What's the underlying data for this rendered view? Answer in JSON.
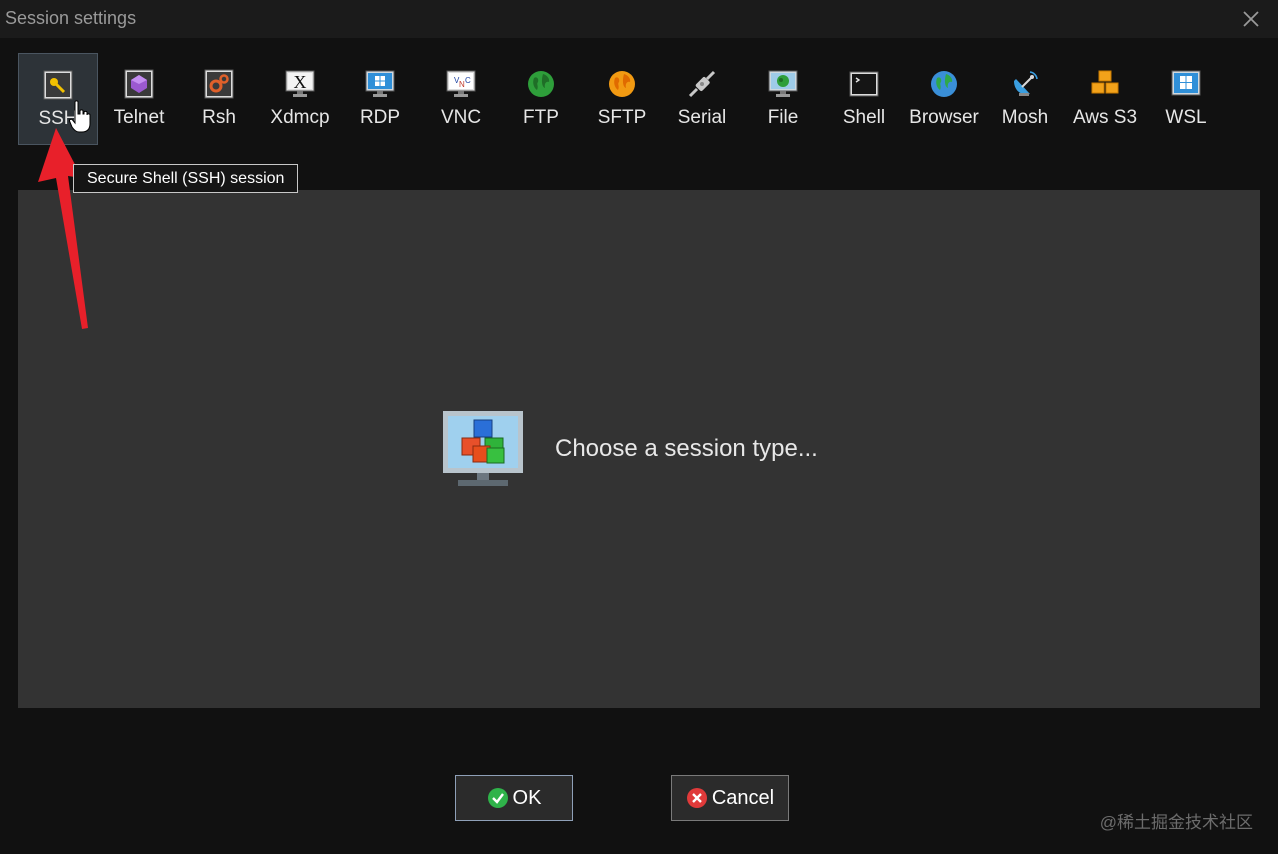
{
  "window": {
    "title": "Session settings"
  },
  "toolbar": {
    "items": [
      {
        "label": "SSH",
        "icon": "key-icon"
      },
      {
        "label": "Telnet",
        "icon": "telnet-icon"
      },
      {
        "label": "Rsh",
        "icon": "rsh-icon"
      },
      {
        "label": "Xdmcp",
        "icon": "xdmcp-icon"
      },
      {
        "label": "RDP",
        "icon": "rdp-icon"
      },
      {
        "label": "VNC",
        "icon": "vnc-icon"
      },
      {
        "label": "FTP",
        "icon": "ftp-globe-icon"
      },
      {
        "label": "SFTP",
        "icon": "sftp-globe-icon"
      },
      {
        "label": "Serial",
        "icon": "serial-plug-icon"
      },
      {
        "label": "File",
        "icon": "file-monitor-icon"
      },
      {
        "label": "Shell",
        "icon": "shell-terminal-icon"
      },
      {
        "label": "Browser",
        "icon": "browser-globe-icon"
      },
      {
        "label": "Mosh",
        "icon": "mosh-satellite-icon"
      },
      {
        "label": "Aws S3",
        "icon": "aws-s3-cubes-icon"
      },
      {
        "label": "WSL",
        "icon": "wsl-windows-icon"
      }
    ],
    "selected": "SSH",
    "tooltip": "Secure Shell (SSH) session"
  },
  "main": {
    "placeholder": "Choose a session type..."
  },
  "buttons": {
    "ok": "OK",
    "cancel": "Cancel"
  },
  "watermark": "@稀土掘金技术社区",
  "colors": {
    "window_bg": "#111111",
    "panel_bg": "#333333",
    "annotation_arrow": "#e8202a"
  }
}
